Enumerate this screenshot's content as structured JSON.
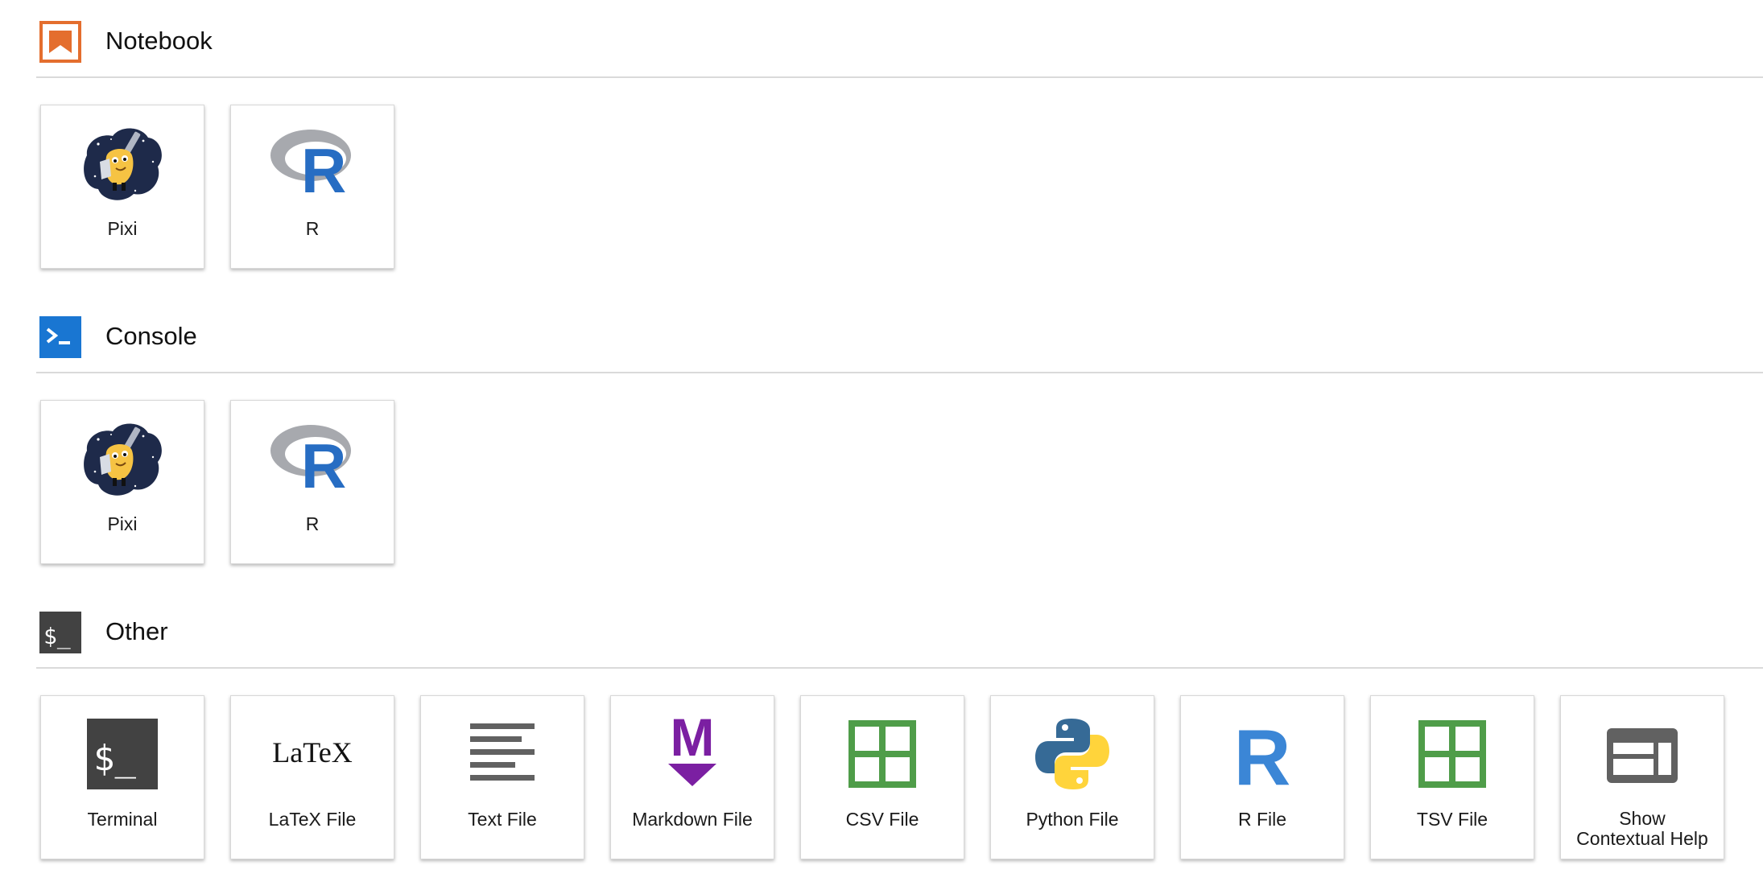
{
  "sections": {
    "notebook": {
      "title": "Notebook",
      "icon": "notebook-icon",
      "cards": [
        {
          "label": "Pixi",
          "icon": "pixi-mascot-icon"
        },
        {
          "label": "R",
          "icon": "r-logo-icon"
        }
      ]
    },
    "console": {
      "title": "Console",
      "icon": "console-icon",
      "cards": [
        {
          "label": "Pixi",
          "icon": "pixi-mascot-icon"
        },
        {
          "label": "R",
          "icon": "r-logo-icon"
        }
      ]
    },
    "other": {
      "title": "Other",
      "icon": "terminal-icon",
      "cards": [
        {
          "label": "Terminal",
          "icon": "terminal-icon"
        },
        {
          "label": "LaTeX File",
          "icon": "latex-icon"
        },
        {
          "label": "Text File",
          "icon": "text-file-icon"
        },
        {
          "label": "Markdown File",
          "icon": "markdown-icon"
        },
        {
          "label": "CSV File",
          "icon": "csv-file-icon"
        },
        {
          "label": "Python File",
          "icon": "python-icon"
        },
        {
          "label": "R File",
          "icon": "r-file-icon"
        },
        {
          "label": "TSV File",
          "icon": "tsv-file-icon"
        },
        {
          "label": "Show\nContextual Help",
          "icon": "contextual-help-icon"
        }
      ]
    }
  },
  "icon_text": {
    "terminal_prompt": "$_",
    "latex": "LaTeX",
    "markdown_m": "M",
    "r_letter": "R"
  },
  "colors": {
    "notebook_orange": "#e46e2e",
    "console_blue": "#1976d2",
    "terminal_dark": "#424242",
    "csv_green": "#4f9d49",
    "markdown_purple": "#7b1fa2",
    "r_blue": "#276dc3",
    "python_blue": "#366a96",
    "python_yellow": "#ffd43b"
  }
}
